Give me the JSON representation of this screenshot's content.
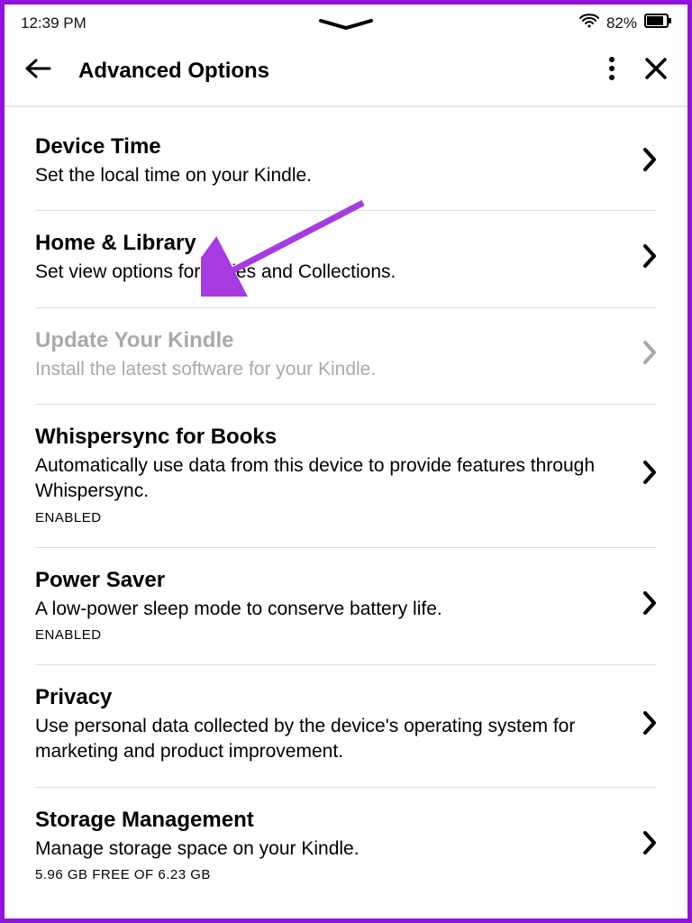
{
  "status": {
    "time": "12:39 PM",
    "battery_pct": "82%"
  },
  "header": {
    "title": "Advanced Options"
  },
  "rows": [
    {
      "title": "Device Time",
      "desc": "Set the local time on your Kindle.",
      "status": "",
      "disabled": false
    },
    {
      "title": "Home & Library",
      "desc": "Set view options for series and Collections.",
      "status": "",
      "disabled": false
    },
    {
      "title": "Update Your Kindle",
      "desc": "Install the latest software for your Kindle.",
      "status": "",
      "disabled": true
    },
    {
      "title": "Whispersync for Books",
      "desc": "Automatically use data from this device to provide features through Whispersync.",
      "status": "ENABLED",
      "disabled": false
    },
    {
      "title": "Power Saver",
      "desc": "A low-power sleep mode to conserve battery life.",
      "status": "ENABLED",
      "disabled": false
    },
    {
      "title": "Privacy",
      "desc": "Use personal data collected by the device's operating system for marketing and product improvement.",
      "status": "",
      "disabled": false
    },
    {
      "title": "Storage Management",
      "desc": "Manage storage space on your Kindle.",
      "status": "5.96 GB FREE OF 6.23 GB",
      "disabled": false
    }
  ]
}
